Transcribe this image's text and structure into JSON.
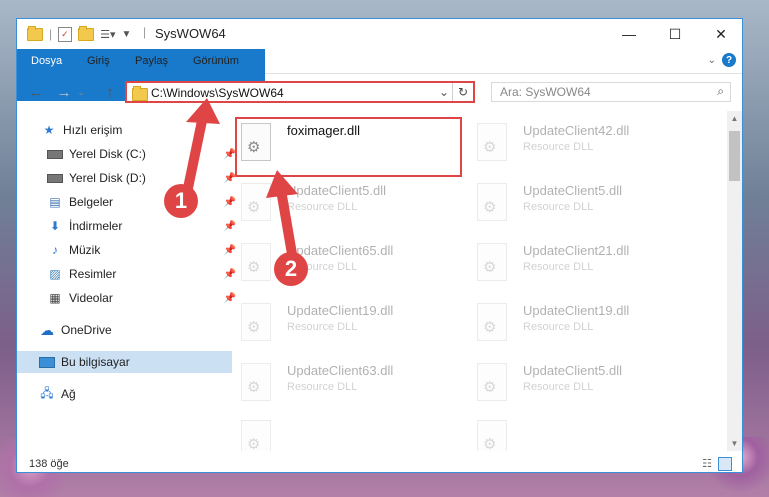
{
  "window": {
    "title": "SysWOW64",
    "controls": {
      "minimize": "—",
      "maximize": "☐",
      "close": "✕"
    }
  },
  "ribbon": {
    "tabs": [
      "Dosya",
      "Giriş",
      "Paylaş",
      "Görünüm"
    ],
    "help_glyph": "?"
  },
  "address": {
    "path": "C:\\Windows\\SysWOW64",
    "search_placeholder": "Ara: SysWOW64"
  },
  "sidebar": {
    "items": [
      {
        "label": "Hızlı erişim",
        "icon": "star-icon"
      },
      {
        "label": "Yerel Disk (C:)",
        "icon": "drive-icon",
        "pinned": true
      },
      {
        "label": "Yerel Disk (D:)",
        "icon": "drive-icon",
        "pinned": true
      },
      {
        "label": "Belgeler",
        "icon": "documents-icon",
        "pinned": true
      },
      {
        "label": "İndirmeler",
        "icon": "download-icon",
        "pinned": true
      },
      {
        "label": "Müzik",
        "icon": "music-icon",
        "pinned": true
      },
      {
        "label": "Resimler",
        "icon": "pictures-icon",
        "pinned": true
      },
      {
        "label": "Videolar",
        "icon": "videos-icon",
        "pinned": true
      },
      {
        "label": "OneDrive",
        "icon": "cloud-icon"
      },
      {
        "label": "Bu bilgisayar",
        "icon": "computer-icon",
        "selected": true
      },
      {
        "label": "Ağ",
        "icon": "network-icon"
      }
    ]
  },
  "files": [
    {
      "name": "foximager.dll",
      "desc": "",
      "highlight": true
    },
    {
      "name": "UpdateClient42.dll",
      "desc": "Resource DLL"
    },
    {
      "name": "UpdateClient5.dll",
      "desc": "Resource DLL"
    },
    {
      "name": "UpdateClient5.dll",
      "desc": "Resource DLL"
    },
    {
      "name": "UpdateClient65.dll",
      "desc": "Resource DLL"
    },
    {
      "name": "UpdateClient21.dll",
      "desc": "Resource DLL"
    },
    {
      "name": "UpdateClient19.dll",
      "desc": "Resource DLL"
    },
    {
      "name": "UpdateClient19.dll",
      "desc": "Resource DLL"
    },
    {
      "name": "UpdateClient63.dll",
      "desc": "Resource DLL"
    },
    {
      "name": "UpdateClient5.dll",
      "desc": "Resource DLL"
    }
  ],
  "status": {
    "count": "138 öğe"
  },
  "annotations": {
    "badge1": "1",
    "badge2": "2",
    "color": "#e04545"
  }
}
